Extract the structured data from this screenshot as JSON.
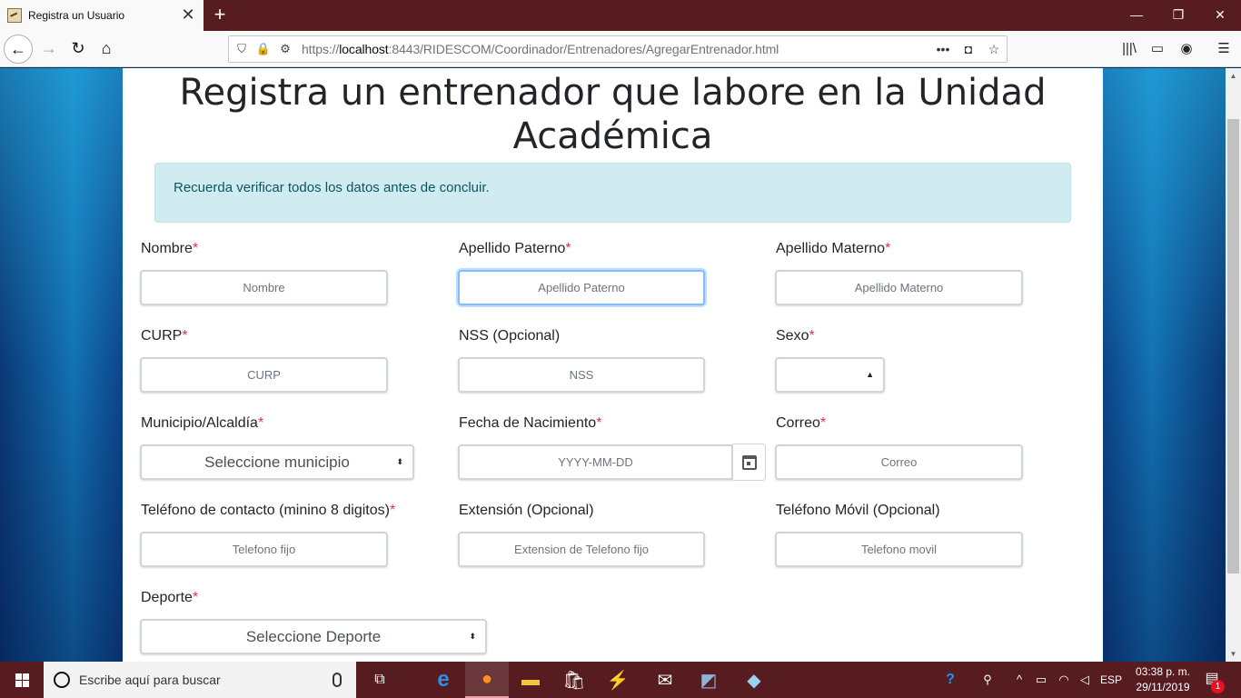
{
  "browser": {
    "tab_title": "Registra un Usuario",
    "url_prefix": "https://",
    "url_host": "localhost",
    "url_rest": ":8443/RIDESCOM/Coordinador/Entrenadores/AgregarEntrenador.html"
  },
  "page": {
    "title": "Registra un entrenador que labore en la Unidad Académica",
    "alert": "Recuerda verificar todos los datos antes de concluir.",
    "required_mark": "*"
  },
  "form": {
    "nombre": {
      "label": "Nombre",
      "placeholder": "Nombre"
    },
    "apellido_paterno": {
      "label": "Apellido Paterno",
      "placeholder": "Apellido Paterno"
    },
    "apellido_materno": {
      "label": "Apellido Materno",
      "placeholder": "Apellido Materno"
    },
    "curp": {
      "label": "CURP",
      "placeholder": "CURP"
    },
    "nss": {
      "label": "NSS (Opcional)",
      "placeholder": "NSS"
    },
    "sexo": {
      "label": "Sexo",
      "value": ""
    },
    "municipio": {
      "label": "Municipio/Alcaldía",
      "value": "Seleccione municipio"
    },
    "fecha": {
      "label": "Fecha de Nacimiento",
      "placeholder": "YYYY-MM-DD"
    },
    "correo": {
      "label": "Correo",
      "placeholder": "Correo"
    },
    "telefono": {
      "label": "Teléfono de contacto (minino 8 digitos)",
      "placeholder": "Telefono fijo"
    },
    "extension": {
      "label": "Extensión (Opcional)",
      "placeholder": "Extension de Telefono fijo"
    },
    "movil": {
      "label": "Teléfono Móvil (Opcional)",
      "placeholder": "Telefono movil"
    },
    "deporte": {
      "label": "Deporte",
      "value": "Seleccione Deporte"
    }
  },
  "taskbar": {
    "search_placeholder": "Escribe aquí para buscar",
    "language": "ESP",
    "time": "03:38 p. m.",
    "date": "29/11/2019",
    "notification_count": "1"
  }
}
